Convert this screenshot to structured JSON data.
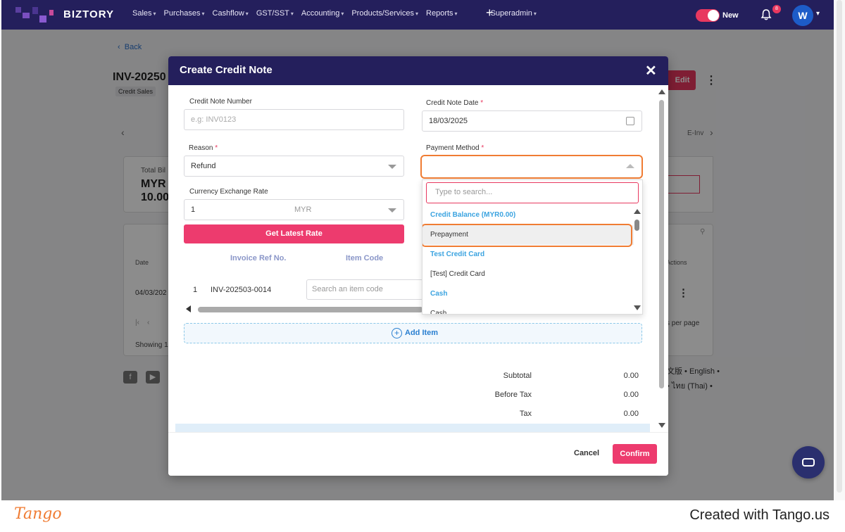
{
  "app": {
    "brand": "BIZTORY",
    "nav": [
      "Sales",
      "Purchases",
      "Cashflow",
      "GST/SST",
      "Accounting",
      "Products/Services",
      "Reports",
      "Superadmin"
    ],
    "plus": "+",
    "toggle_label": "New",
    "notification_count": "8",
    "avatar_initial": "W",
    "colors": {
      "nav_bg": "#241f5c",
      "accent": "#ed3b6e",
      "highlight": "#f07c33",
      "link": "#3aa3e0"
    }
  },
  "background": {
    "back_label": "Back",
    "invoice_title": "INV-20250",
    "invoice_badge": "Credit Sales",
    "edit_label": "Edit",
    "tab_einvoice": "E-Inv",
    "total_label": "Total Bil",
    "total_currency": "MYR",
    "total_amount": "10.00",
    "col_date": "Date",
    "col_actions": "Actions",
    "row_date": "04/03/202",
    "per_page": "s per page",
    "showing": "Showing 1",
    "langs_line1": "文版 • English •",
    "langs_line2": "• ไทย (Thai) •"
  },
  "modal": {
    "title": "Create Credit Note",
    "credit_note_number": {
      "label": "Credit Note Number",
      "placeholder": "e.g: INV0123",
      "value": ""
    },
    "credit_note_date": {
      "label": "Credit Note Date",
      "value": "18/03/2025"
    },
    "reason": {
      "label": "Reason",
      "value": "Refund"
    },
    "payment_method": {
      "label": "Payment Method",
      "value": ""
    },
    "currency_rate": {
      "label": "Currency Exchange Rate",
      "value": "1",
      "currency": "MYR"
    },
    "get_rate_label": "Get Latest Rate",
    "items_header": {
      "ref": "Invoice Ref No.",
      "code": "Item Code"
    },
    "items": [
      {
        "num": "1",
        "ref": "INV-202503-0014",
        "item_placeholder": "Search an item code"
      }
    ],
    "add_item_label": "Add Item",
    "totals": [
      {
        "label": "Subtotal",
        "value": "0.00"
      },
      {
        "label": "Before Tax",
        "value": "0.00"
      },
      {
        "label": "Tax",
        "value": "0.00"
      }
    ],
    "cancel_label": "Cancel",
    "confirm_label": "Confirm"
  },
  "dropdown": {
    "search_placeholder": "Type to search...",
    "options": [
      {
        "label": "Credit Balance (MYR0.00)",
        "kind": "group"
      },
      {
        "label": "Prepayment",
        "kind": "item",
        "highlighted": true
      },
      {
        "label": "Test Credit Card",
        "kind": "group"
      },
      {
        "label": "[Test] Credit Card",
        "kind": "item"
      },
      {
        "label": "Cash",
        "kind": "group"
      },
      {
        "label": "Cash",
        "kind": "item"
      }
    ]
  },
  "tango": {
    "logo": "Tango",
    "credit": "Created with Tango.us"
  }
}
